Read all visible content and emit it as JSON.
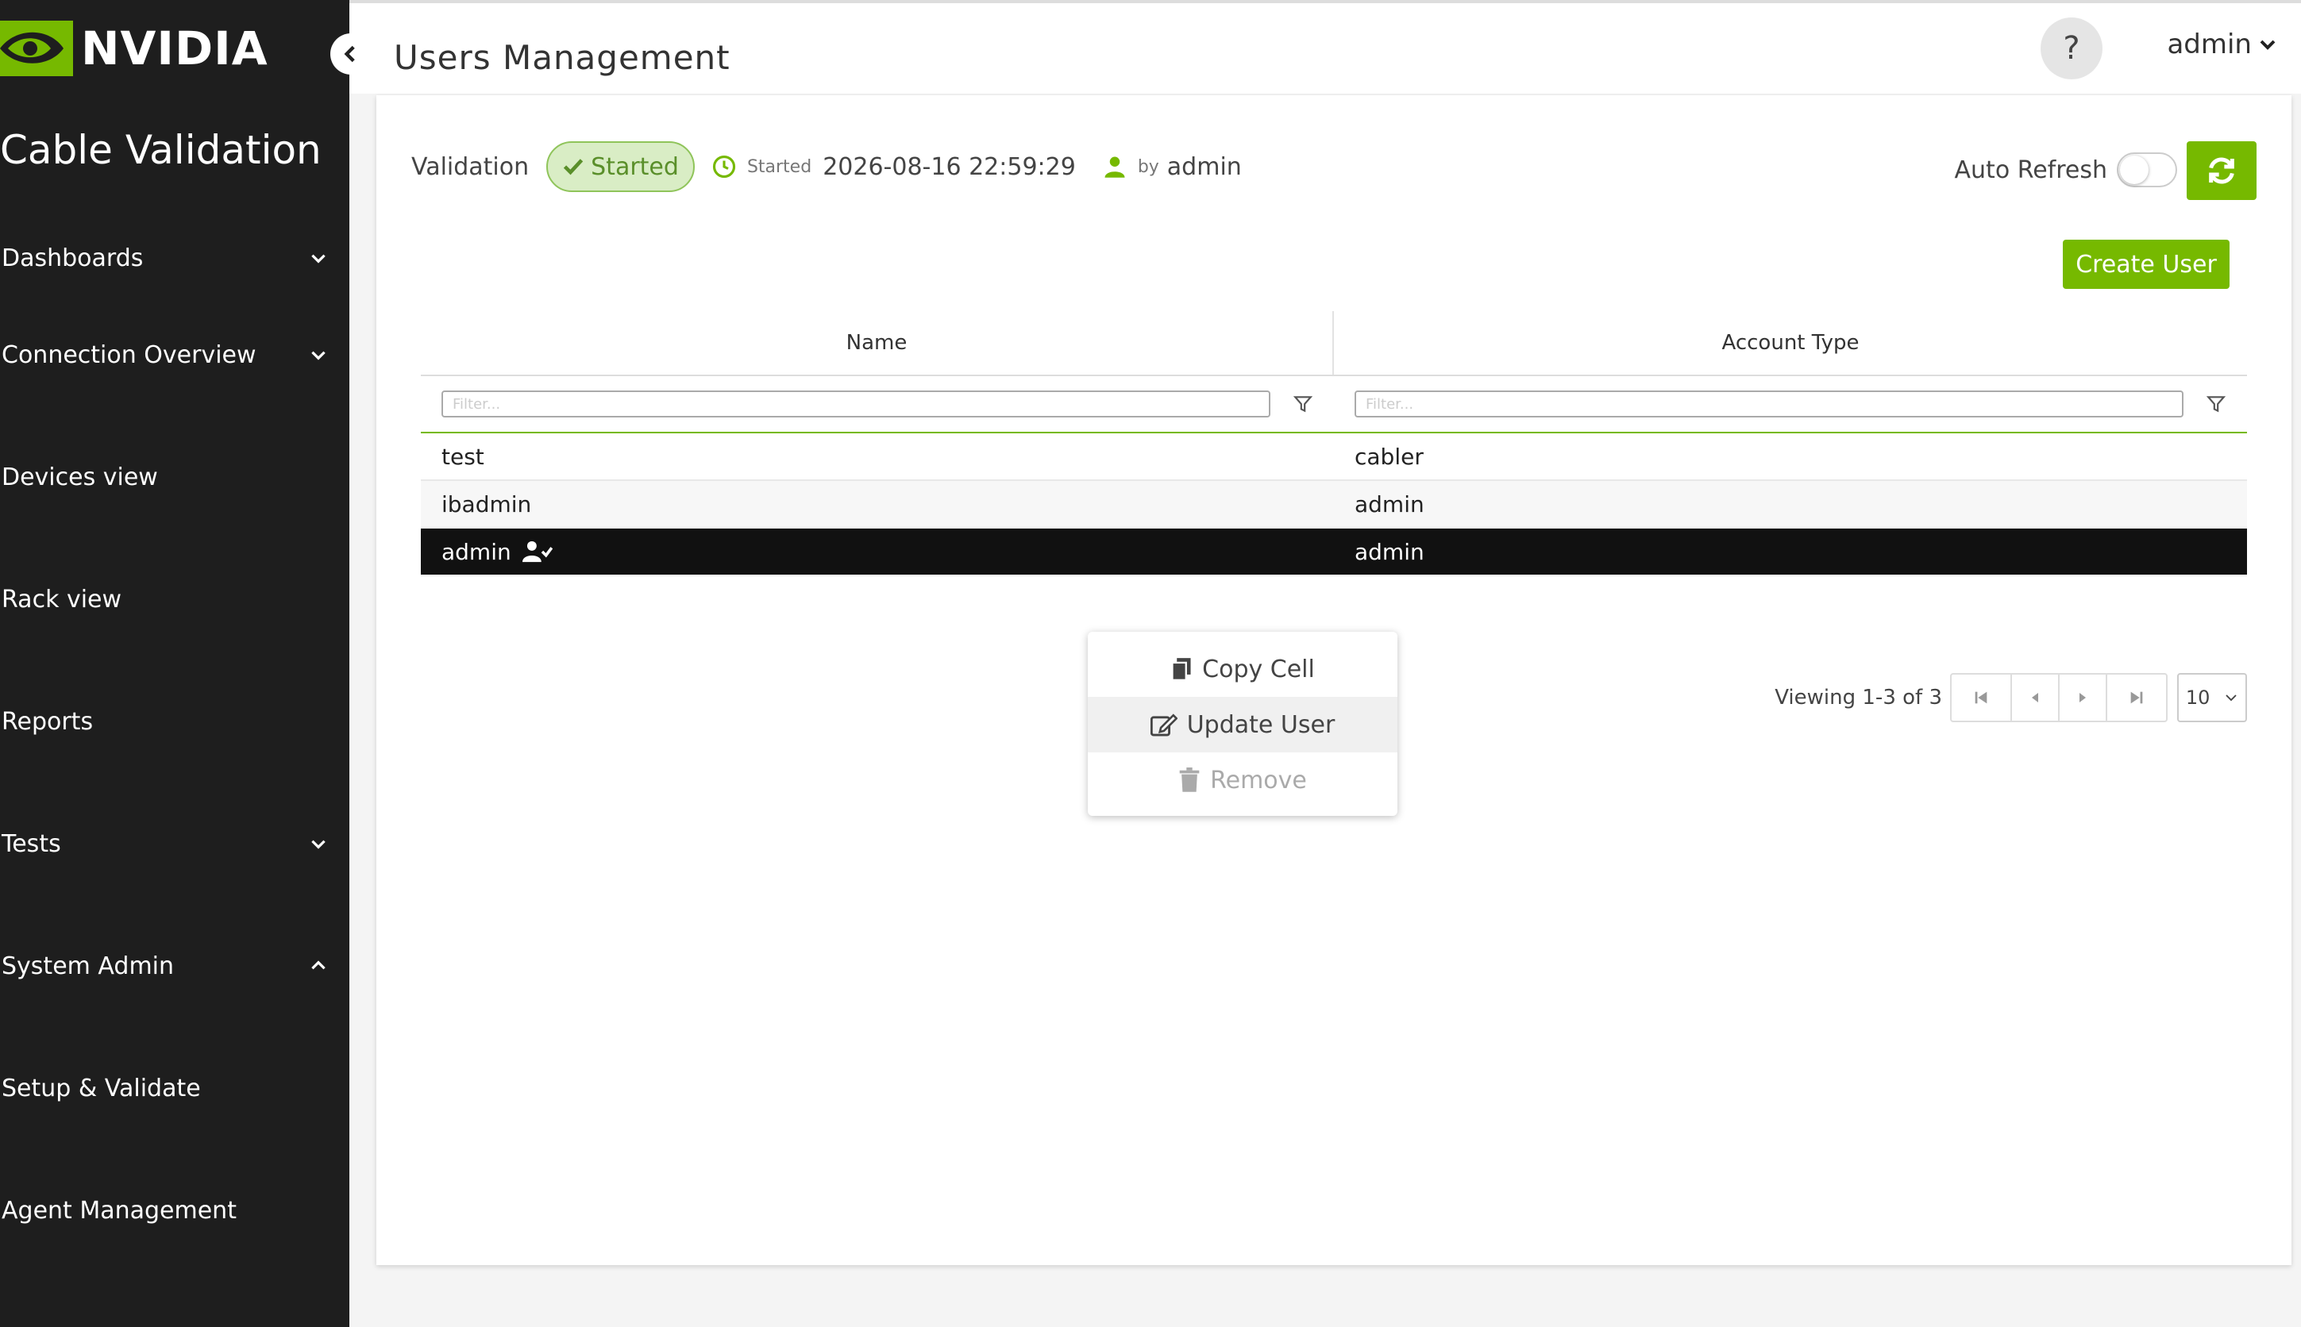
{
  "app": {
    "brand": "NVIDIA",
    "title": "Cable Validation"
  },
  "sidebar": {
    "items": [
      {
        "label": "Dashboards",
        "chevron": "down"
      },
      {
        "label": "Connection Overview",
        "chevron": "down"
      },
      {
        "label": "Devices view",
        "chevron": ""
      },
      {
        "label": "Rack view",
        "chevron": ""
      },
      {
        "label": "Reports",
        "chevron": ""
      },
      {
        "label": "Tests",
        "chevron": "down"
      },
      {
        "label": "System Admin",
        "chevron": "up"
      },
      {
        "label": "Setup & Validate",
        "chevron": ""
      },
      {
        "label": "Agent Management",
        "chevron": ""
      }
    ]
  },
  "header": {
    "page_title": "Users Management",
    "help": "?",
    "user": "admin"
  },
  "status": {
    "label": "Validation",
    "state": "Started",
    "started_label": "Started",
    "started_at": "2026-08-16 22:59:29",
    "by_label": "by",
    "by_user": "admin"
  },
  "controls": {
    "auto_refresh_label": "Auto Refresh",
    "auto_refresh_on": false,
    "create_user_label": "Create User"
  },
  "table": {
    "columns": [
      "Name",
      "Account Type"
    ],
    "filter_placeholder": "Filter...",
    "rows": [
      {
        "name": "test",
        "type": "cabler"
      },
      {
        "name": "ibadmin",
        "type": "admin"
      },
      {
        "name": "admin",
        "type": "admin"
      }
    ]
  },
  "context_menu": {
    "items": [
      {
        "label": "Copy Cell"
      },
      {
        "label": "Update User"
      },
      {
        "label": "Remove"
      }
    ]
  },
  "pagination": {
    "text": "Viewing 1-3 of 3",
    "page_size": "10"
  },
  "colors": {
    "accent": "#76b900",
    "sidebar": "#1e1e1e"
  }
}
